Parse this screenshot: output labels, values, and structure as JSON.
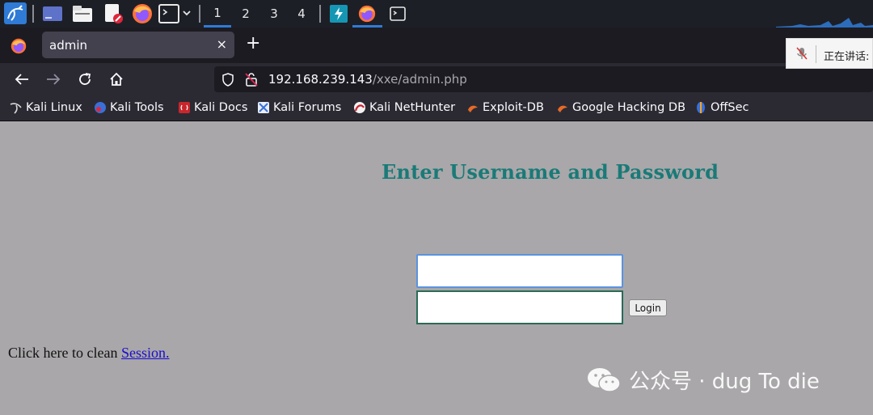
{
  "taskbar": {
    "workspaces": [
      "1",
      "2",
      "3",
      "4"
    ],
    "active_workspace": "1"
  },
  "browser": {
    "tab_title": "admin",
    "tab_close": "×",
    "new_tab": "+",
    "url_host": "192.168.239.143",
    "url_path": "/xxe/admin.php"
  },
  "notification": {
    "label": "正在讲话:"
  },
  "bookmarks": [
    {
      "label": "Kali Linux",
      "icon": "kali-dragon-icon"
    },
    {
      "label": "Kali Tools",
      "icon": "kali-tools-icon"
    },
    {
      "label": "Kali Docs",
      "icon": "kali-docs-icon"
    },
    {
      "label": "Kali Forums",
      "icon": "kali-forums-icon"
    },
    {
      "label": "Kali NetHunter",
      "icon": "kali-nethunter-icon"
    },
    {
      "label": "Exploit-DB",
      "icon": "exploit-db-icon"
    },
    {
      "label": "Google Hacking DB",
      "icon": "ghdb-icon"
    },
    {
      "label": "OffSec",
      "icon": "offsec-icon"
    }
  ],
  "page": {
    "heading": "Enter Username and Password",
    "username_value": "",
    "password_value": "",
    "login_label": "Login",
    "clean_text": "Click here to clean ",
    "session_link": "Session."
  },
  "watermark": {
    "text": "公众号 · dug To die"
  },
  "colors": {
    "page_bg": "#a9a7a9",
    "heading": "#1a7a78",
    "link": "#1a0dcc",
    "taskbar_accent": "#2f7bd6"
  }
}
